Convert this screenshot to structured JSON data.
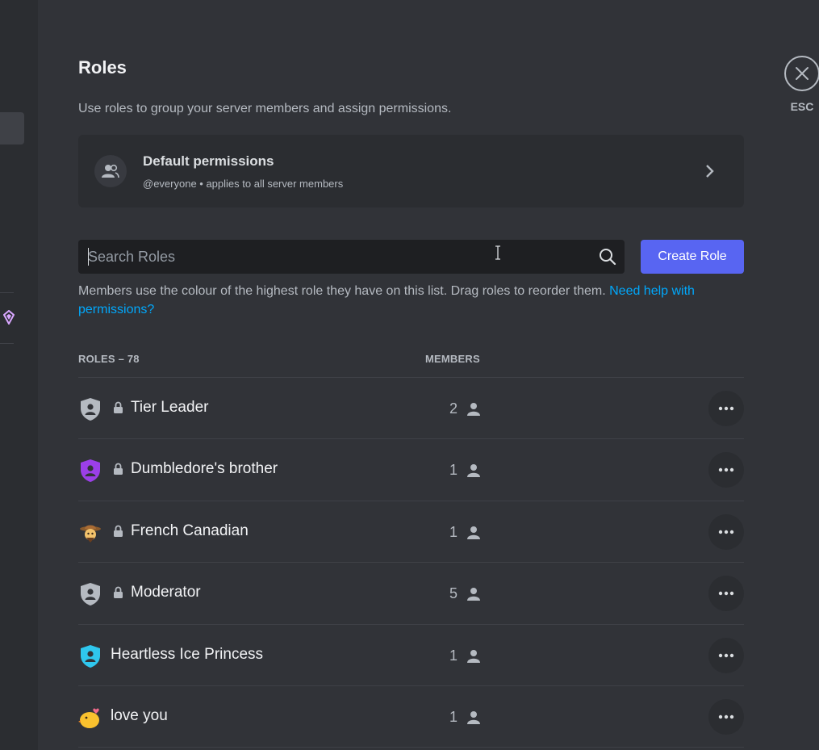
{
  "page": {
    "title": "Roles",
    "subtitle": "Use roles to group your server members and assign permissions."
  },
  "default_permissions": {
    "title": "Default permissions",
    "subtitle": "@everyone • applies to all server members"
  },
  "search": {
    "placeholder": "Search Roles",
    "value": ""
  },
  "create_button": {
    "label": "Create Role"
  },
  "help": {
    "text": "Members use the colour of the highest role they have on this list. Drag roles to reorder them. ",
    "link": "Need help with permissions?"
  },
  "columns": {
    "roles": "ROLES – 78",
    "members": "MEMBERS"
  },
  "roles": [
    {
      "name": "Tier Leader",
      "members": "2",
      "locked": true,
      "icon": "shield-icon",
      "color": "#b5bac1"
    },
    {
      "name": "Dumbledore's brother",
      "members": "1",
      "locked": true,
      "icon": "shield-icon",
      "color": "#9b3fe8"
    },
    {
      "name": "French Canadian",
      "members": "1",
      "locked": true,
      "icon": "cowboy-emoji-icon",
      "color": "#c48a3a"
    },
    {
      "name": "Moderator",
      "members": "5",
      "locked": true,
      "icon": "shield-icon",
      "color": "#b5bac1"
    },
    {
      "name": "Heartless Ice Princess",
      "members": "1",
      "locked": false,
      "icon": "shield-icon",
      "color": "#2fc7ee"
    },
    {
      "name": "love you",
      "members": "1",
      "locked": false,
      "icon": "chick-emoji-icon",
      "color": "#f9c12e"
    }
  ],
  "close": {
    "label": "ESC"
  }
}
